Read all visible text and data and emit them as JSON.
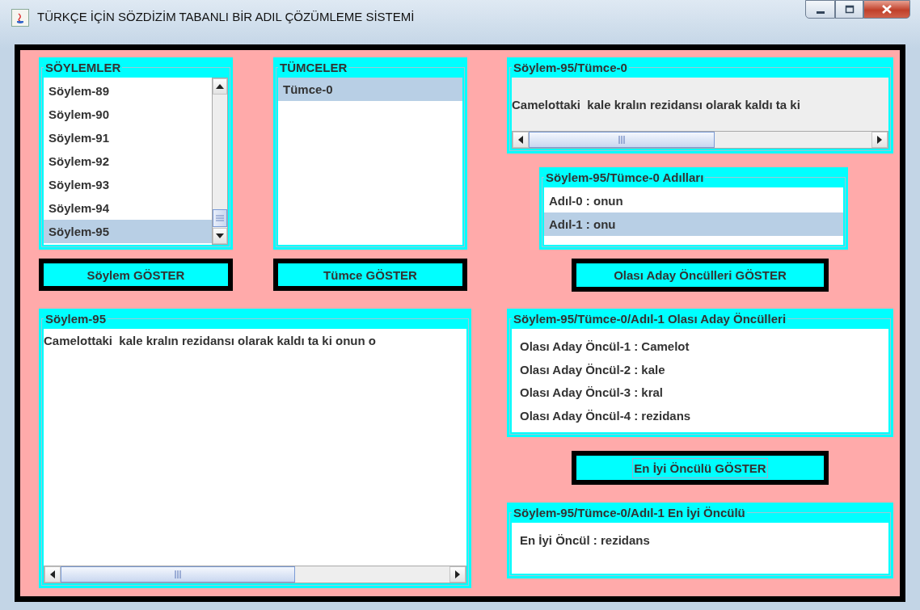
{
  "window": {
    "title": "TÜRKÇE İÇİN SÖZDİZİM TABANLI BİR ADIL ÇÖZÜMLEME SİSTEMİ"
  },
  "utterances": {
    "title": "SÖYLEMLER",
    "items": [
      {
        "label": "Söylem-89",
        "selected": false
      },
      {
        "label": "Söylem-90",
        "selected": false
      },
      {
        "label": "Söylem-91",
        "selected": false
      },
      {
        "label": "Söylem-92",
        "selected": false
      },
      {
        "label": "Söylem-93",
        "selected": false
      },
      {
        "label": "Söylem-94",
        "selected": false
      },
      {
        "label": "Söylem-95",
        "selected": true
      }
    ],
    "button": {
      "label": "Söylem GÖSTER",
      "focused": false
    }
  },
  "sentences": {
    "title": "TÜMCELER",
    "items": [
      {
        "label": "Tümce-0",
        "selected": true
      }
    ],
    "button": {
      "label": "Tümce GÖSTER",
      "focused": false
    }
  },
  "utterance_view": {
    "title": "Söylem-95",
    "text": "Camelottaki  kale kralın rezidansı olarak kaldı ta ki onun o"
  },
  "sentence_view": {
    "title": "Söylem-95/Tümce-0",
    "text": "Camelottaki  kale kralın rezidansı olarak kaldı ta ki"
  },
  "pronouns": {
    "title": "Söylem-95/Tümce-0 Adılları",
    "items": [
      {
        "label": "Adıl-0 : onun",
        "selected": false
      },
      {
        "label": "Adıl-1 : onu",
        "selected": true
      }
    ],
    "button": {
      "label": "Olası Aday Öncülleri GÖSTER",
      "focused": false
    }
  },
  "candidates": {
    "title": "Söylem-95/Tümce-0/Adıl-1 Olası Aday Öncülleri",
    "items": [
      "Olası Aday Öncül-1 : Camelot",
      "Olası Aday Öncül-2 : kale",
      "Olası Aday Öncül-3 : kral",
      "Olası Aday Öncül-4 : rezidans"
    ],
    "button": {
      "label": "En İyi Öncülü GÖSTER",
      "focused": true
    }
  },
  "best": {
    "title": "Söylem-95/Tümce-0/Adıl-1 En İyi Öncülü",
    "text": "En İyi Öncül : rezidans"
  }
}
